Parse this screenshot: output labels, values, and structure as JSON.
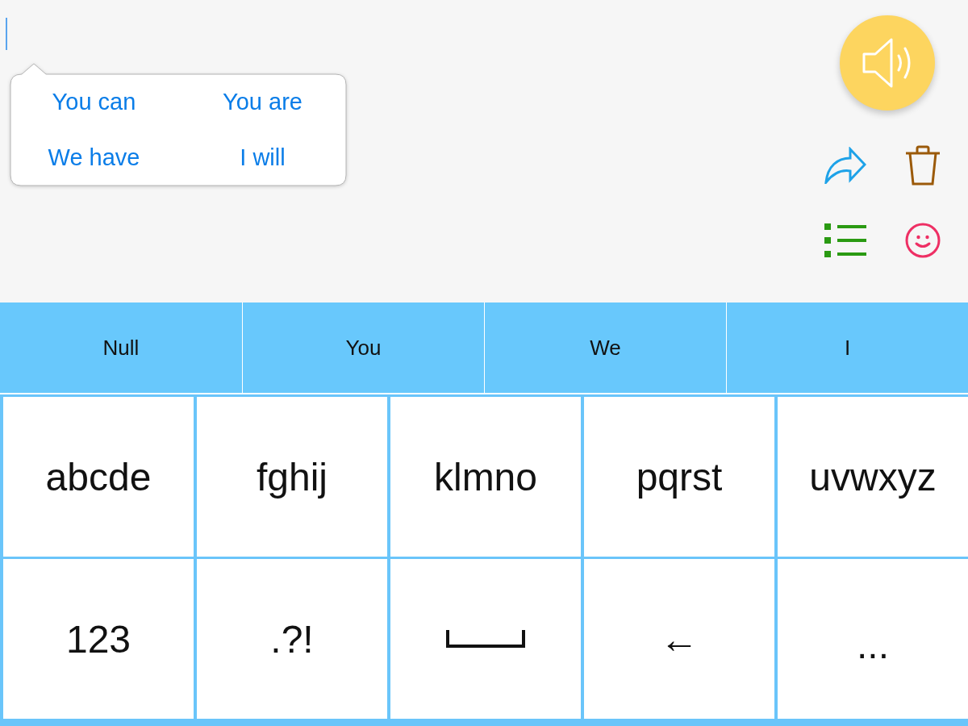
{
  "message_field": {
    "focused": true
  },
  "phrase_suggestions": [
    {
      "label": "You can"
    },
    {
      "label": "You are"
    },
    {
      "label": "We have"
    },
    {
      "label": "I will"
    }
  ],
  "word_predictions": [
    {
      "label": "Null"
    },
    {
      "label": "You"
    },
    {
      "label": "We"
    },
    {
      "label": "I"
    }
  ],
  "keyboard": {
    "rows": [
      [
        {
          "kind": "letters",
          "label": "abcde"
        },
        {
          "kind": "letters",
          "label": "fghij"
        },
        {
          "kind": "letters",
          "label": "klmno"
        },
        {
          "kind": "letters",
          "label": "pqrst"
        },
        {
          "kind": "letters",
          "label": "uvwxyz"
        }
      ],
      [
        {
          "kind": "numbers",
          "label": "123"
        },
        {
          "kind": "punctuation",
          "label": ".?!"
        },
        {
          "kind": "space"
        },
        {
          "kind": "backspace",
          "label": "←"
        },
        {
          "kind": "more",
          "label": "..."
        }
      ]
    ]
  }
}
